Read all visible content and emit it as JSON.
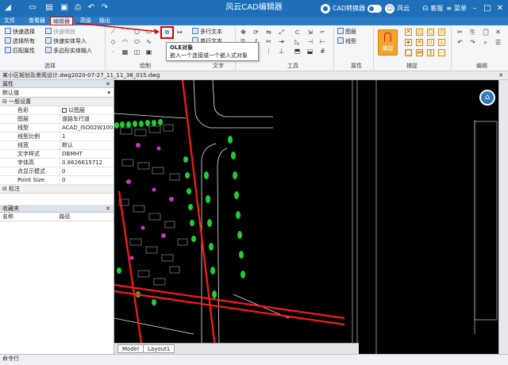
{
  "app": {
    "title": "风云CAD编辑器"
  },
  "titlebar": {
    "converter_label": "CAD转换器",
    "user_label": "风云",
    "service_label": "客服",
    "vip_label": "菜单"
  },
  "menu": {
    "tabs": [
      "文件",
      "查看器",
      "编辑器",
      "高级",
      "输出"
    ],
    "active": "编辑器"
  },
  "ribbon": {
    "select_group": {
      "label": "选择",
      "items": [
        "快速选择",
        "选择所有",
        "匹配属性",
        "快速缩放",
        "快速实体导入",
        "多边形实体输入"
      ]
    },
    "draw_group": {
      "label": "绘制"
    },
    "text_group": {
      "label": "文字",
      "items": [
        "多行文本",
        "单行文本"
      ]
    },
    "tools_group": {
      "label": "工具"
    },
    "props_group": {
      "label": "属性",
      "items": [
        "图层",
        "线型"
      ]
    },
    "snap_group": {
      "label": "捕捉",
      "capture_label": "捕捉"
    },
    "edit_group": {
      "label": "编辑"
    }
  },
  "tooltip": {
    "title": "OLE对象",
    "desc": "嵌入一个连接或一个嵌入式对象"
  },
  "document": {
    "tab_title": "某小区规划及景观设计.dwg2020-07-27_11_11_38_015.dwg"
  },
  "properties": {
    "header": "属性",
    "selector": "默认值",
    "section_general": "一般设置",
    "rows": [
      {
        "key": "色彩",
        "value": "以图层"
      },
      {
        "key": "图层",
        "value": "道路车行道"
      },
      {
        "key": "线型",
        "value": "ACAD_ISO02W100"
      },
      {
        "key": "线型比例",
        "value": "1"
      },
      {
        "key": "线宽",
        "value": "默认"
      },
      {
        "key": "文字样式",
        "value": "DBMHT"
      },
      {
        "key": "字体高",
        "value": "0.8626615712"
      },
      {
        "key": "点显示模式",
        "value": "0"
      },
      {
        "key": "Point Size",
        "value": "0"
      }
    ],
    "section_annotation": "标注"
  },
  "favorites": {
    "header": "收藏夹",
    "col_name": "名称",
    "col_path": "路径"
  },
  "layouts": {
    "tabs": [
      "Model",
      "Layout1"
    ]
  },
  "command": {
    "label": "命令行"
  },
  "colors": {
    "titlebar": "#1e6fb8",
    "accent_red": "#dd0000",
    "cad_background": "#000000",
    "road_red": "#ff1a1a",
    "tree_green": "#22cc33"
  }
}
